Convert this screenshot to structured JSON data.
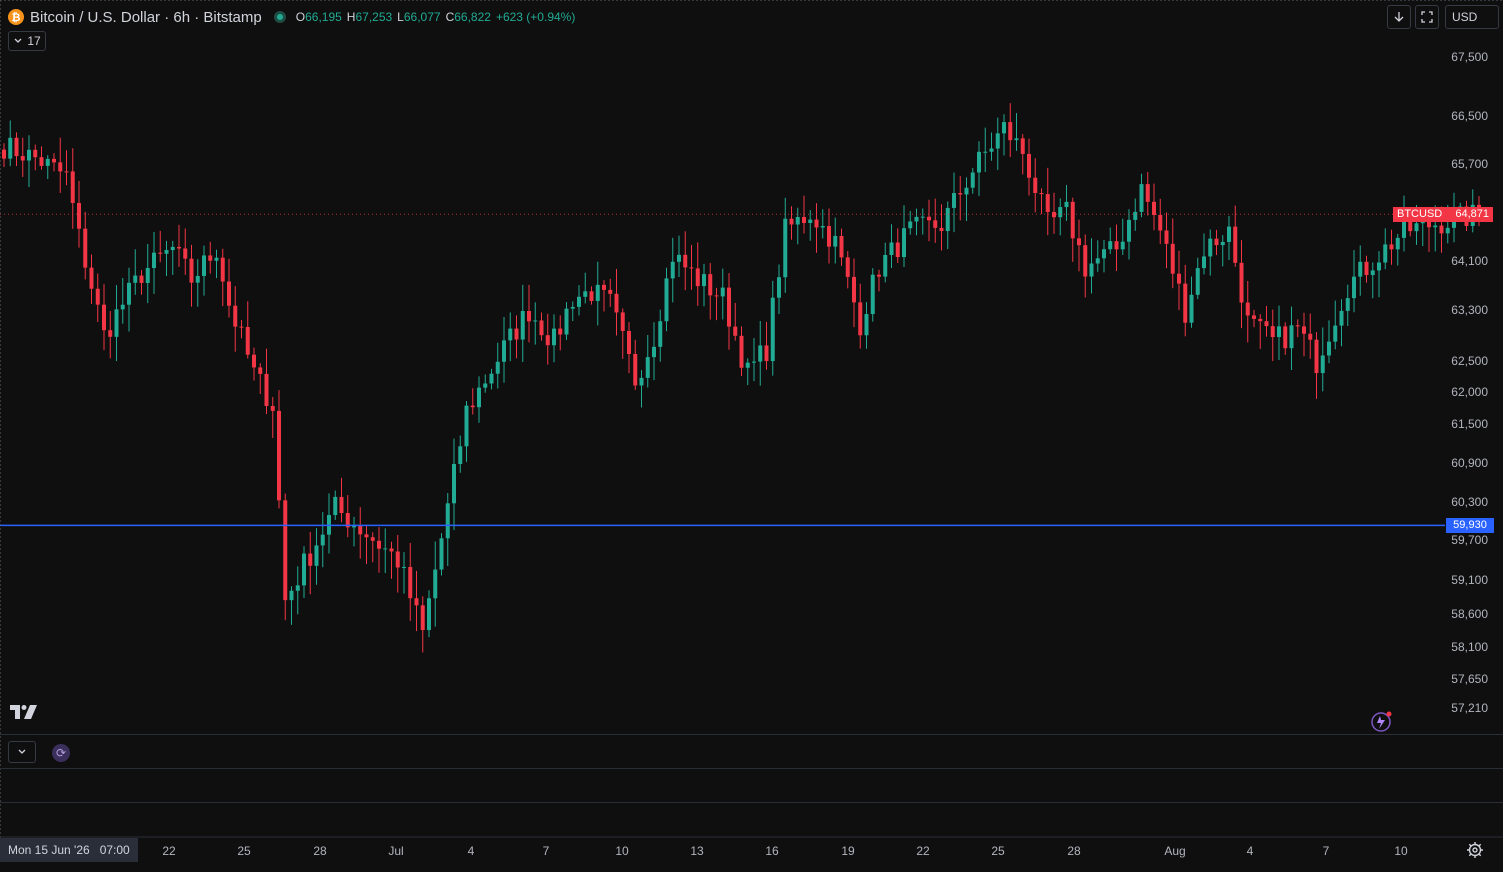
{
  "header": {
    "logo_glyph": "₿",
    "symbol": "Bitcoin / U.S. Dollar · 6h · Bitstamp",
    "o_key": "O",
    "o_val": "66,195",
    "h_key": "H",
    "h_val": "67,253",
    "l_key": "L",
    "l_val": "66,077",
    "c_key": "C",
    "c_val": "66,822",
    "change": "+623 (+0.94%)",
    "indicators_count": "17"
  },
  "toolbar": {
    "currency": "USD",
    "download_icon": "arrow-down-icon",
    "fullscreen_icon": "fullscreen-icon"
  },
  "price_axis": {
    "labels": [
      "67,500",
      "66,500",
      "65,700",
      "64,100",
      "63,300",
      "62,500",
      "62,000",
      "61,500",
      "60,900",
      "60,300",
      "59,700",
      "59,100",
      "58,600",
      "58,100",
      "57,650",
      "57,210"
    ],
    "last_price_symbol": "BTCUSD",
    "last_price": "64,871",
    "hline_price": "59,930"
  },
  "time_axis": {
    "current_date": "Mon 15 Jun '26",
    "current_time": "07:00",
    "labels": [
      "22",
      "25",
      "28",
      "Jul",
      "4",
      "7",
      "10",
      "13",
      "16",
      "19",
      "22",
      "25",
      "28",
      "Aug",
      "4",
      "7",
      "10"
    ]
  },
  "colors": {
    "up": "#22ab94",
    "down": "#f23645",
    "hline": "#2962ff",
    "background": "#0f0f0f",
    "grid": "#2a2e39"
  },
  "chart_data": {
    "type": "candlestick",
    "symbol": "BTCUSD",
    "interval": "6h",
    "ylim": [
      57000,
      67800
    ],
    "horizontal_line": 59930,
    "last_price": 64871,
    "anchors": [
      [
        0,
        66000
      ],
      [
        5,
        65800
      ],
      [
        10,
        65500
      ],
      [
        12,
        64500
      ],
      [
        16,
        62900
      ],
      [
        22,
        63900
      ],
      [
        27,
        64300
      ],
      [
        30,
        63800
      ],
      [
        34,
        64300
      ],
      [
        36,
        63400
      ],
      [
        40,
        62300
      ],
      [
        43,
        61800
      ],
      [
        45,
        58800
      ],
      [
        49,
        59500
      ],
      [
        53,
        60200
      ],
      [
        58,
        59800
      ],
      [
        63,
        59400
      ],
      [
        67,
        58300
      ],
      [
        71,
        60200
      ],
      [
        74,
        61700
      ],
      [
        80,
        62700
      ],
      [
        84,
        63300
      ],
      [
        88,
        62800
      ],
      [
        91,
        63500
      ],
      [
        94,
        63600
      ],
      [
        97,
        63400
      ],
      [
        101,
        62200
      ],
      [
        104,
        62900
      ],
      [
        107,
        64200
      ],
      [
        111,
        63800
      ],
      [
        115,
        63500
      ],
      [
        119,
        62300
      ],
      [
        122,
        62700
      ],
      [
        125,
        64600
      ],
      [
        129,
        64900
      ],
      [
        133,
        64400
      ],
      [
        137,
        63100
      ],
      [
        140,
        64000
      ],
      [
        145,
        64600
      ],
      [
        150,
        64700
      ],
      [
        155,
        65600
      ],
      [
        160,
        66300
      ],
      [
        163,
        65900
      ],
      [
        167,
        64700
      ],
      [
        170,
        64900
      ],
      [
        173,
        64000
      ],
      [
        178,
        64300
      ],
      [
        182,
        65300
      ],
      [
        185,
        64600
      ],
      [
        189,
        63300
      ],
      [
        192,
        64300
      ],
      [
        196,
        64600
      ],
      [
        199,
        63100
      ],
      [
        203,
        62800
      ],
      [
        207,
        63000
      ],
      [
        210,
        62500
      ],
      [
        215,
        63700
      ],
      [
        220,
        64200
      ],
      [
        224,
        64600
      ],
      [
        228,
        64700
      ],
      [
        233,
        64800
      ],
      [
        236,
        64871
      ]
    ]
  }
}
